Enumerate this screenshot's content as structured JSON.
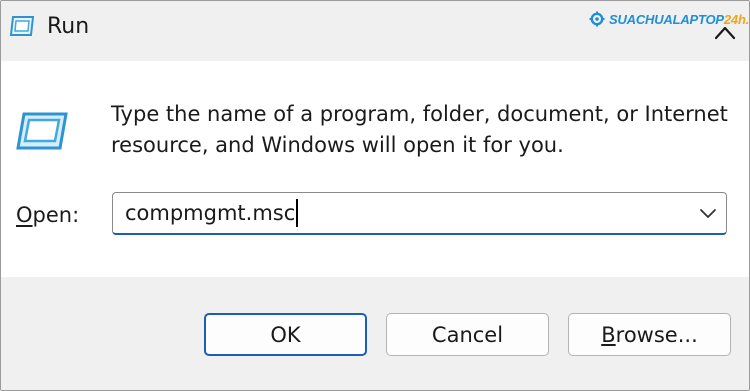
{
  "window": {
    "title": "Run",
    "title_icon": "run-dialog-icon",
    "close_icon": "close-icon"
  },
  "watermark": {
    "prefix": "SUACHUALAPTOP",
    "suffix": "24h.com",
    "icon": "gear-icon",
    "color": "#1e8fd6",
    "accent_color": "#f0a51a"
  },
  "main": {
    "icon": "run-dialog-icon",
    "description_line1": "Type the name of a program, folder, document, or Internet",
    "description_line2": "resource, and Windows will open it for you."
  },
  "open_field": {
    "label_accel": "O",
    "label_rest": "pen:",
    "value": "compmgmt.msc",
    "dropdown_icon": "chevron-down-icon"
  },
  "buttons": {
    "ok": "OK",
    "cancel": "Cancel",
    "browse_accel": "B",
    "browse_rest": "rowse..."
  },
  "colors": {
    "accent": "#1a5fb4",
    "titlebar_bg": "#f0f0f0",
    "footer_bg": "#f0f0f0",
    "icon_cyan": "#3fa9e0"
  }
}
